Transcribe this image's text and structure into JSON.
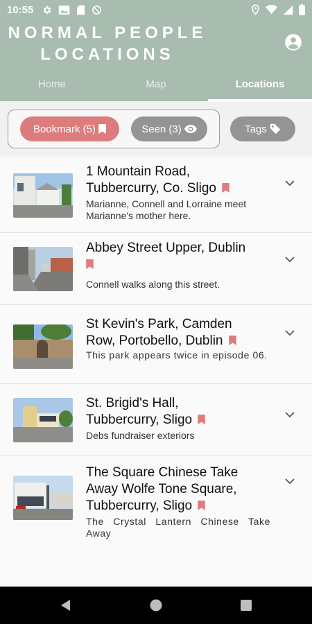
{
  "status_bar": {
    "time": "10:55",
    "left_icons": [
      "gear-icon",
      "photo-icon",
      "sd-card-icon",
      "no-sync-icon"
    ],
    "right_icons": [
      "location-icon",
      "wifi-icon",
      "signal-icon",
      "battery-icon"
    ]
  },
  "app": {
    "title": "NORMAL PEOPLE LOCATIONS",
    "title_line1": "NORMAL PEOPLE",
    "title_line2": "LOCATIONS",
    "header_color": "#a8bdb0"
  },
  "tabs": [
    {
      "label": "Home",
      "active": false
    },
    {
      "label": "Map",
      "active": false
    },
    {
      "label": "Locations",
      "active": true
    }
  ],
  "filters": {
    "bookmark": {
      "label": "Bookmark (5)",
      "icon": "bookmark-icon",
      "color": "#dc7c7c"
    },
    "seen": {
      "label": "Seen (3)",
      "icon": "eye-icon",
      "color": "#949494"
    },
    "tags": {
      "label": "Tags",
      "icon": "tag-icon",
      "color": "#949494"
    }
  },
  "locations": [
    {
      "title": "1 Mountain Road, Tubbercurry, Co. Sligo",
      "title_lines": [
        "1 Mountain Road,",
        "Tubbercurry, Co. Sligo"
      ],
      "description": "Marianne, Connell and Lorraine meet Marianne's mother here.",
      "bookmarked": true
    },
    {
      "title": "Abbey Street Upper, Dublin",
      "title_lines": [
        "Abbey Street Upper, Dublin",
        ""
      ],
      "description": "Connell walks along this street.",
      "bookmarked": true
    },
    {
      "title": "St Kevin's Park, Camden Row, Portobello, Dublin",
      "title_lines": [
        "St Kevin's Park, Camden",
        "Row, Portobello, Dublin"
      ],
      "description": "This park appears twice in episode 06.",
      "bookmarked": true
    },
    {
      "title": "St. Brigid's Hall, Tubbercurry, Sligo",
      "title_lines": [
        "St. Brigid's Hall,",
        "Tubbercurry, Sligo"
      ],
      "description": "Debs fundraiser exteriors",
      "bookmarked": true
    },
    {
      "title": "The Square Chinese Take Away Wolfe Tone Square, Tubbercurry, Sligo",
      "title_lines": [
        "The Square Chinese Take",
        "Away Wolfe Tone Square,",
        "Tubbercurry, Sligo"
      ],
      "description": "The Crystal Lantern Chinese Take Away",
      "bookmarked": true
    }
  ],
  "colors": {
    "bookmark": "#dc7c7c",
    "chip_grey": "#949494",
    "chevron": "#555555"
  }
}
